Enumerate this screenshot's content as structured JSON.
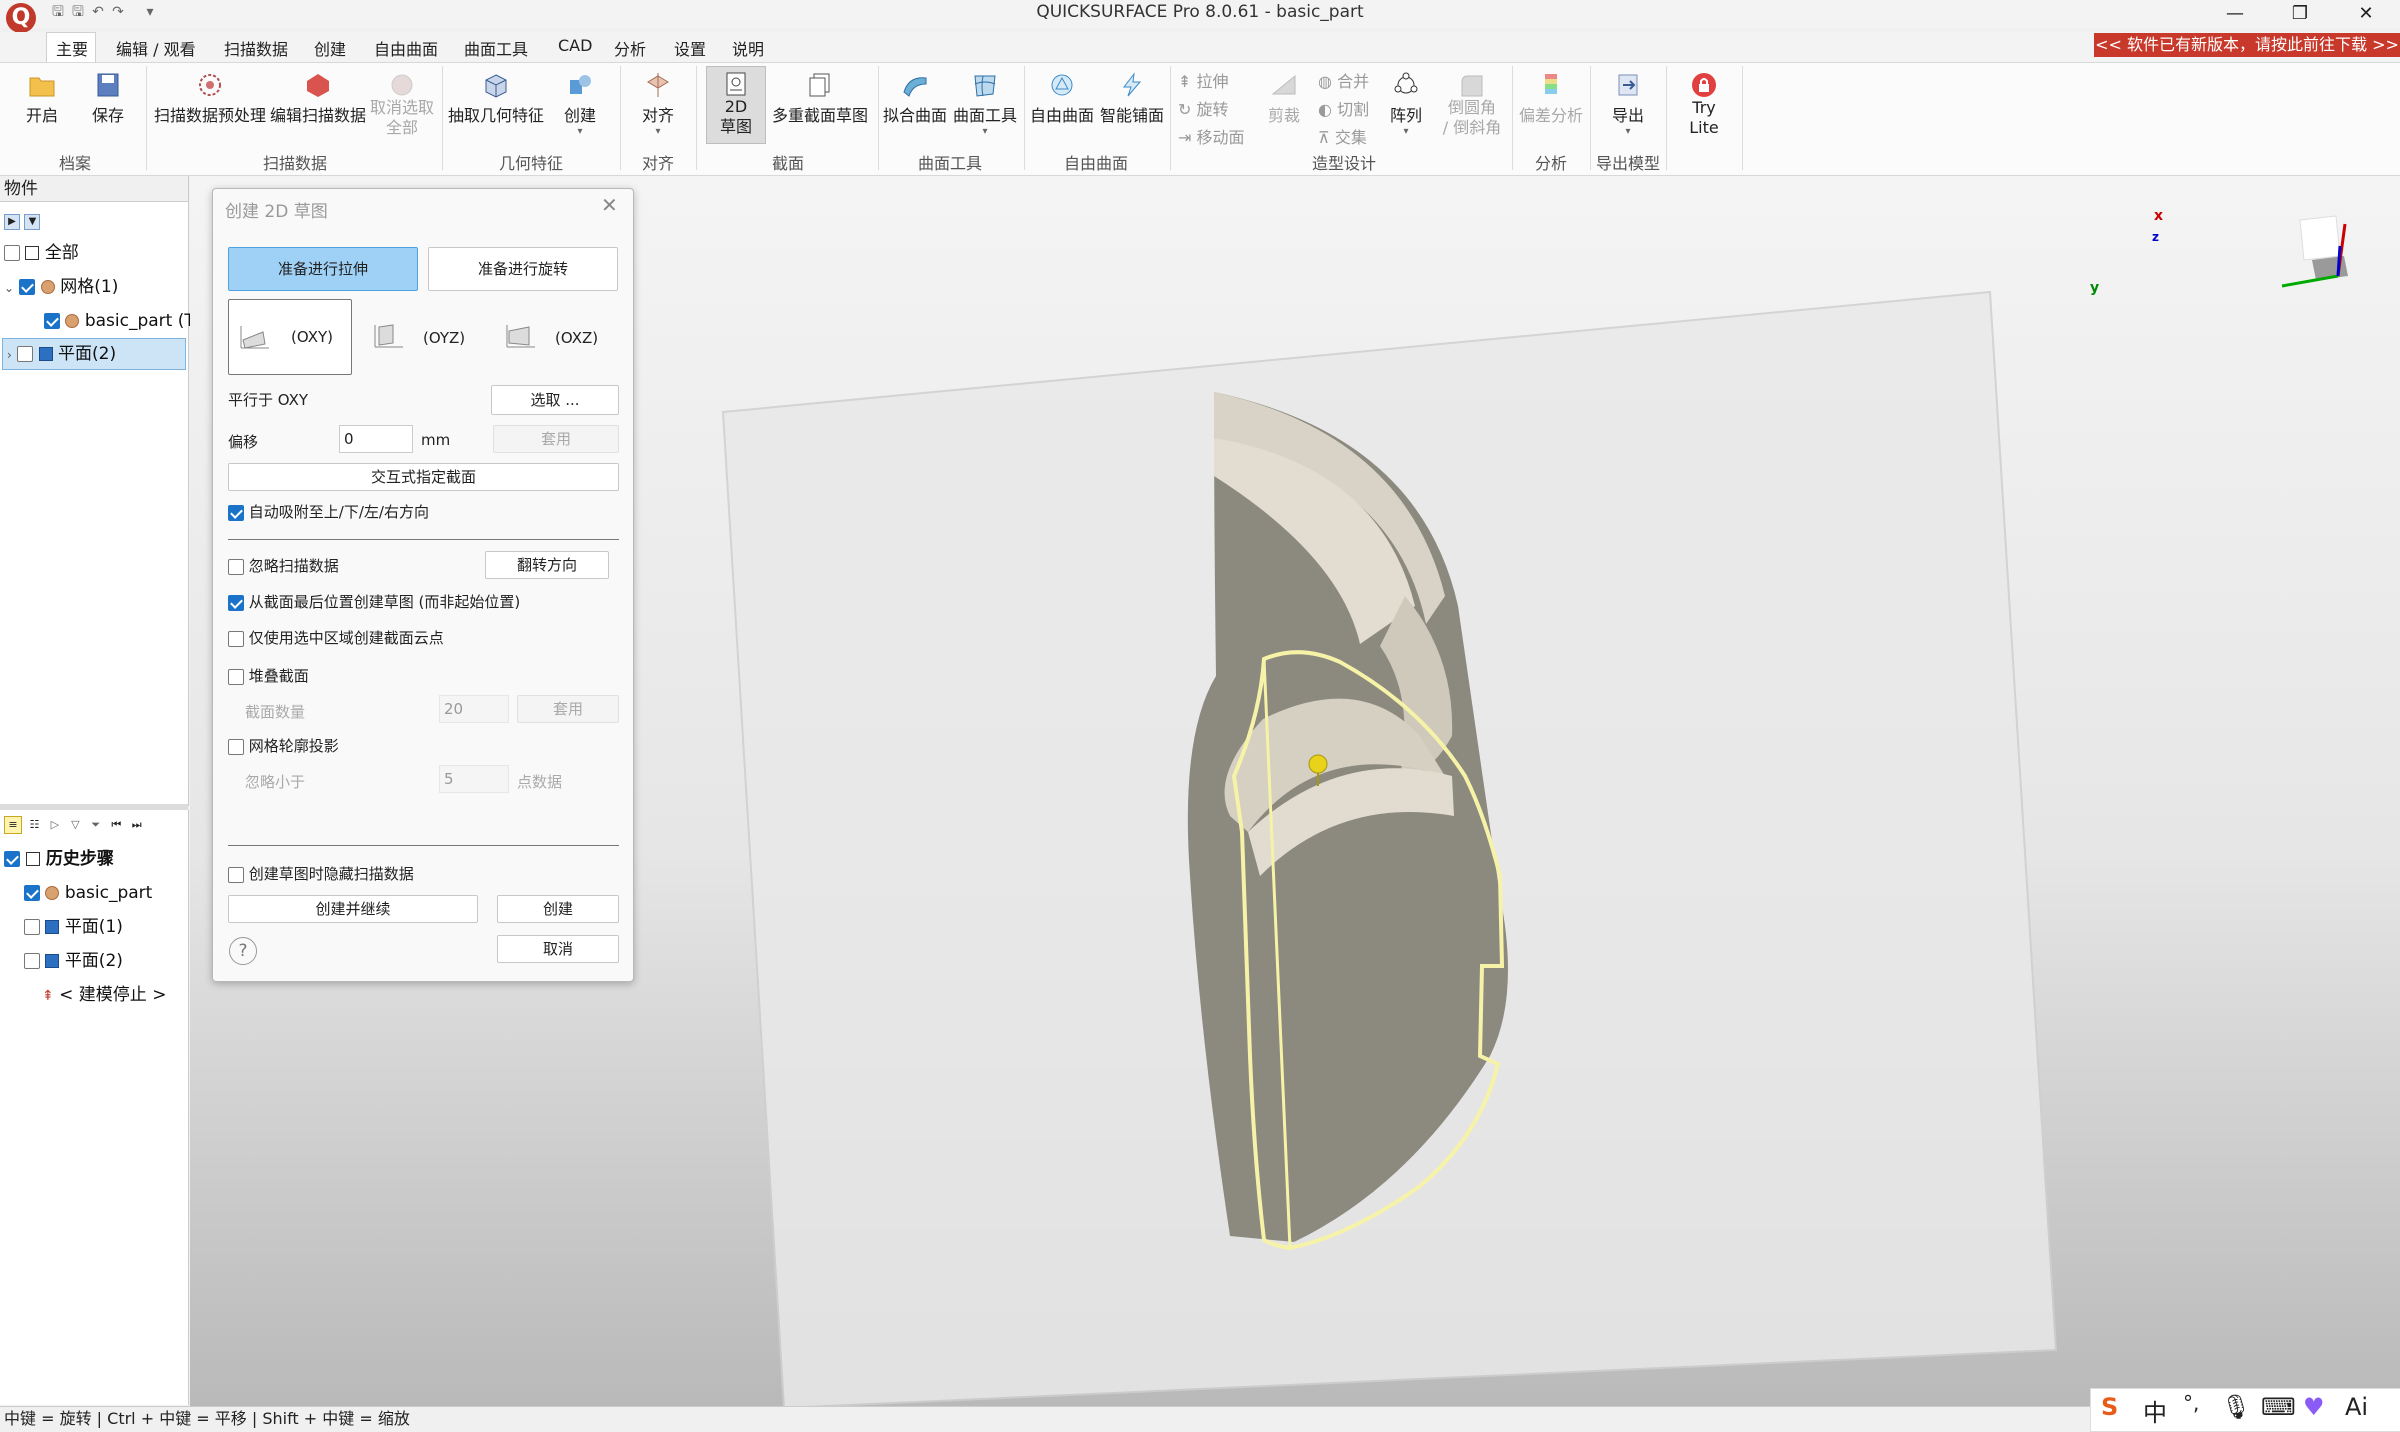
{
  "window": {
    "title": "QUICKSURFACE Pro 8.0.61 - basic_part",
    "minimize": "—",
    "maximize": "❐",
    "close": "✕"
  },
  "menu": {
    "items": [
      "主要",
      "编辑 / 观看",
      "扫描数据",
      "创建",
      "自由曲面",
      "曲面工具",
      "CAD",
      "分析",
      "设置",
      "说明"
    ],
    "active_index": 0,
    "update_banner": "<< 软件已有新版本，请按此前往下载 >>"
  },
  "ribbon": {
    "open": "开启",
    "save": "保存",
    "group_file": "档案",
    "scan_preprocess": "扫描数据预处理",
    "edit_scan": "编辑扫描数据",
    "deselect_all_1": "取消选取",
    "deselect_all_2": "全部",
    "group_scan": "扫描数据",
    "extract_features": "抽取几何特征",
    "create": "创建",
    "group_geometry": "几何特征",
    "align": "对齐",
    "group_align": "对齐",
    "sketch_2d_1": "2D",
    "sketch_2d_2": "草图",
    "multi_section": "多重截面草图",
    "group_section": "截面",
    "fit_surface": "拟合曲面",
    "surface_tools": "曲面工具",
    "group_surface_tools": "曲面工具",
    "free_surface": "自由曲面",
    "smart_surface": "智能铺面",
    "group_free_surface": "自由曲面",
    "extrude": "拉伸",
    "revolve": "旋转",
    "move_face": "移动面",
    "trim": "剪裁",
    "union": "合并",
    "cut": "切割",
    "intersect": "交集",
    "pattern": "阵列",
    "fillet_1": "倒圆角",
    "fillet_2": "/ 倒斜角",
    "group_modeling": "造型设计",
    "deviation": "偏差分析",
    "group_analysis": "分析",
    "export": "导出",
    "group_export": "导出模型",
    "try_1": "Try",
    "try_2": "Lite"
  },
  "objects_panel": {
    "header": "物件",
    "items": [
      {
        "label": "全部",
        "checked": false
      },
      {
        "label": "网格(1)",
        "checked": true
      },
      {
        "label": "basic_part (T",
        "checked": true
      },
      {
        "label": "平面(2)",
        "checked": false
      }
    ]
  },
  "history_panel": {
    "items": [
      {
        "label": "历史步骤",
        "checked": true
      },
      {
        "label": "basic_part",
        "checked": true
      },
      {
        "label": "平面(1)",
        "checked": false
      },
      {
        "label": "平面(2)",
        "checked": false
      },
      {
        "label": "< 建模停止 >",
        "checked": null
      }
    ]
  },
  "dialog": {
    "title": "创建 2D 草图",
    "mode_extrude": "准备进行拉伸",
    "mode_revolve": "准备进行旋转",
    "plane_oxy": "(OXY)",
    "plane_oyz": "(OYZ)",
    "plane_oxz": "(OXZ)",
    "parallel_label": "平行于 OXY",
    "select_button": "选取 ...",
    "offset_label": "偏移",
    "offset_value": "0",
    "offset_unit": "mm",
    "apply_button": "套用",
    "interactive_section": "交互式指定截面",
    "auto_snap": "自动吸附至上/下/左/右方向",
    "auto_snap_checked": true,
    "ignore_scan": "忽略扫描数据",
    "ignore_scan_checked": false,
    "flip_direction": "翻转方向",
    "from_last_section": "从截面最后位置创建草图 (而非起始位置)",
    "from_last_section_checked": true,
    "selected_region_only": "仅使用选中区域创建截面云点",
    "selected_region_only_checked": false,
    "stack_sections": "堆叠截面",
    "stack_sections_checked": false,
    "section_count_label": "截面数量",
    "section_count_value": "20",
    "apply_button_2": "套用",
    "mesh_projection": "网格轮廓投影",
    "mesh_projection_checked": false,
    "ignore_less_than": "忽略小于",
    "ignore_value": "5",
    "points_label": "点数据",
    "hide_scan": "创建草图时隐藏扫描数据",
    "hide_scan_checked": false,
    "create_continue": "创建并继续",
    "create": "创建",
    "cancel": "取消",
    "help": "?"
  },
  "viewport": {
    "axis_x": "x",
    "axis_y": "y",
    "axis_z": "z"
  },
  "status": {
    "text": "中键 = 旋转 | Ctrl + 中键 = 平移 | Shift + 中键 = 缩放"
  },
  "ime": {
    "chinese": "中",
    "punct": "°,",
    "ai": "Ai"
  }
}
